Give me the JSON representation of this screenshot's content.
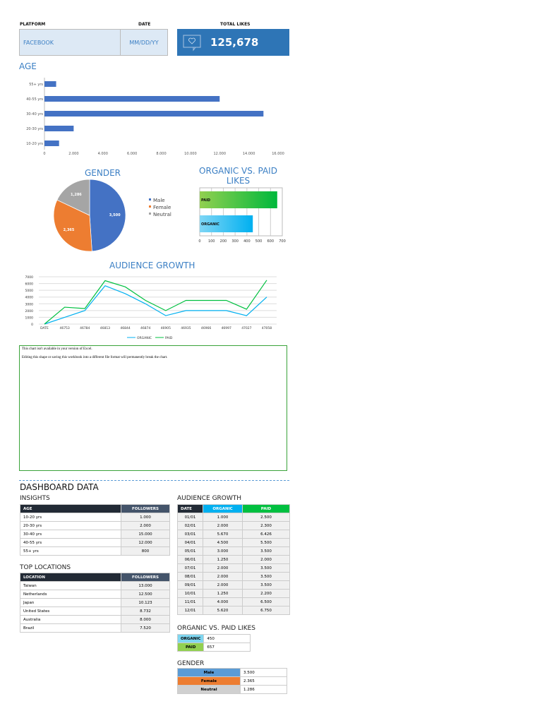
{
  "header": {
    "platform_label": "PLATFORM",
    "platform_value": "FACEBOOK",
    "date_label": "DATE",
    "date_value": "MM/DD/YY",
    "likes_label": "TOTAL LIKES",
    "likes_value": "125,678"
  },
  "colors": {
    "blue": "#4472c4",
    "orange": "#ed7d31",
    "gray": "#a5a5a5",
    "organic": "#00b0f0",
    "paid": "#00c040",
    "header_dark": "#222a35",
    "header_slate": "#44546a"
  },
  "chart_data": [
    {
      "type": "bar",
      "title": "AGE",
      "categories": [
        "55+ yrs",
        "40-55 yrs",
        "30-40 yrs",
        "20-30 yrs",
        "10-20 yrs"
      ],
      "values": [
        800,
        12000,
        15000,
        2000,
        1000
      ],
      "xlim": [
        0,
        16000
      ],
      "xticks": [
        "0",
        "2.000",
        "4.000",
        "6.000",
        "8.000",
        "10.000",
        "12.000",
        "14.000",
        "16.000"
      ]
    },
    {
      "type": "pie",
      "title": "GENDER",
      "categories": [
        "Male",
        "Female",
        "Neutral"
      ],
      "values": [
        3500,
        2365,
        1286
      ],
      "labels": [
        "3,500",
        "2,365",
        "1,286"
      ],
      "legend": "right"
    },
    {
      "type": "bar",
      "title": "ORGANIC VS. PAID LIKES",
      "categories": [
        "PAID",
        "ORGANIC"
      ],
      "values": [
        657,
        450
      ],
      "xlim": [
        0,
        700
      ],
      "xticks": [
        "0",
        "100",
        "200",
        "300",
        "400",
        "500",
        "600",
        "700"
      ]
    },
    {
      "type": "line",
      "title": "AUDIENCE GROWTH",
      "x": [
        "DATE",
        "46753",
        "46784",
        "46813",
        "46844",
        "46874",
        "46905",
        "46935",
        "46966",
        "46997",
        "47027",
        "47058"
      ],
      "series": [
        {
          "name": "ORGANIC",
          "values": [
            0,
            1000,
            2000,
            5670,
            4500,
            3000,
            1250,
            2000,
            2000,
            2000,
            1250,
            4000
          ]
        },
        {
          "name": "PAID",
          "values": [
            0,
            2500,
            2300,
            6426,
            5500,
            3500,
            2000,
            3500,
            3500,
            3500,
            2200,
            6500
          ]
        }
      ],
      "ylim": [
        0,
        7000
      ],
      "yticks": [
        "7000",
        "6000",
        "5000",
        "4000",
        "3000",
        "2000",
        "1000",
        "0"
      ],
      "legend": "bottom"
    }
  ],
  "unavailable": {
    "line1": "This chart isn't available in your version of Excel.",
    "line2": "Editing this shape or saving this workbook into a different file format will permanently break the chart."
  },
  "dashboard": {
    "title": "DASHBOARD DATA",
    "insights": {
      "title": "INSIGHTS",
      "headers": [
        "AGE",
        "FOLLOWERS"
      ],
      "rows": [
        [
          "10-20 yrs",
          "1.000"
        ],
        [
          "20-30 yrs",
          "2.000"
        ],
        [
          "30-40 yrs",
          "15.000"
        ],
        [
          "40-55 yrs",
          "12.000"
        ],
        [
          "55+ yrs",
          "800"
        ]
      ]
    },
    "locations": {
      "title": "TOP LOCATIONS",
      "headers": [
        "LOCATION",
        "FOLLOWERS"
      ],
      "rows": [
        [
          "Taiwan",
          "13.000"
        ],
        [
          "Netherlands",
          "12.500"
        ],
        [
          "Japan",
          "10.123"
        ],
        [
          "United States",
          "8.732"
        ],
        [
          "Australia",
          "8.000"
        ],
        [
          "Brazil",
          "7.520"
        ]
      ]
    },
    "growth": {
      "title": "AUDIENCE GROWTH",
      "headers": [
        "DATE",
        "ORGANIC",
        "PAID"
      ],
      "rows": [
        [
          "01/01",
          "1.000",
          "2.500"
        ],
        [
          "02/01",
          "2.000",
          "2.300"
        ],
        [
          "03/01",
          "5.670",
          "6.426"
        ],
        [
          "04/01",
          "4.500",
          "5.500"
        ],
        [
          "05/01",
          "3.000",
          "3.500"
        ],
        [
          "06/01",
          "1.250",
          "2.000"
        ],
        [
          "07/01",
          "2.000",
          "3.500"
        ],
        [
          "08/01",
          "2.000",
          "3.500"
        ],
        [
          "09/01",
          "2.000",
          "3.500"
        ],
        [
          "10/01",
          "1.250",
          "2.200"
        ],
        [
          "11/01",
          "4.000",
          "6.500"
        ],
        [
          "12/01",
          "5.620",
          "6.750"
        ]
      ]
    },
    "ovp": {
      "title": "ORGANIC VS. PAID LIKES",
      "rows": [
        [
          "ORGANIC",
          "450"
        ],
        [
          "PAID",
          "657"
        ]
      ]
    },
    "gender": {
      "title": "GENDER",
      "rows": [
        [
          "Male",
          "3.500"
        ],
        [
          "Female",
          "2.365"
        ],
        [
          "Neutral",
          "1.286"
        ]
      ]
    }
  }
}
